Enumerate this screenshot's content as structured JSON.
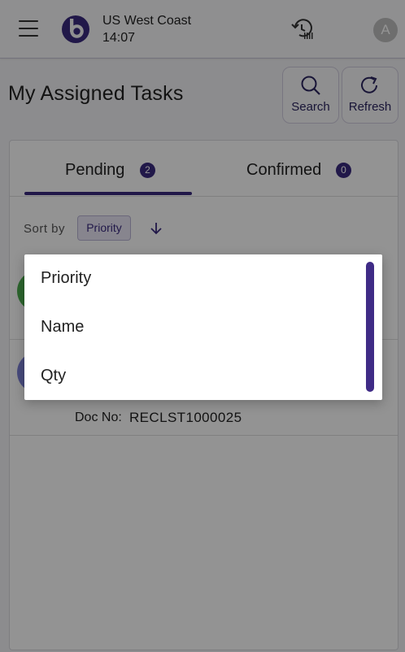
{
  "header": {
    "region": "US West Coast",
    "time": "14:07",
    "avatar_letter": "A"
  },
  "page": {
    "title": "My Assigned Tasks",
    "search_label": "Search",
    "refresh_label": "Refresh"
  },
  "tabs": [
    {
      "label": "Pending",
      "count": "2",
      "selected": true
    },
    {
      "label": "Confirmed",
      "count": "0",
      "selected": false
    }
  ],
  "sort": {
    "label": "Sort by",
    "value": "Priority",
    "direction_icon": "arrow-down-icon"
  },
  "tasks": [
    {
      "avatar_color": "#4cae4f"
    },
    {
      "avatar_color": "#7b80d6",
      "doc_no_label": "Doc No:",
      "doc_no": "RECLST1000025"
    }
  ],
  "dropdown": {
    "options": [
      "Priority",
      "Name",
      "Qty"
    ]
  },
  "colors": {
    "brand": "#3a2a7e",
    "scrollbar": "#3f2b86"
  }
}
